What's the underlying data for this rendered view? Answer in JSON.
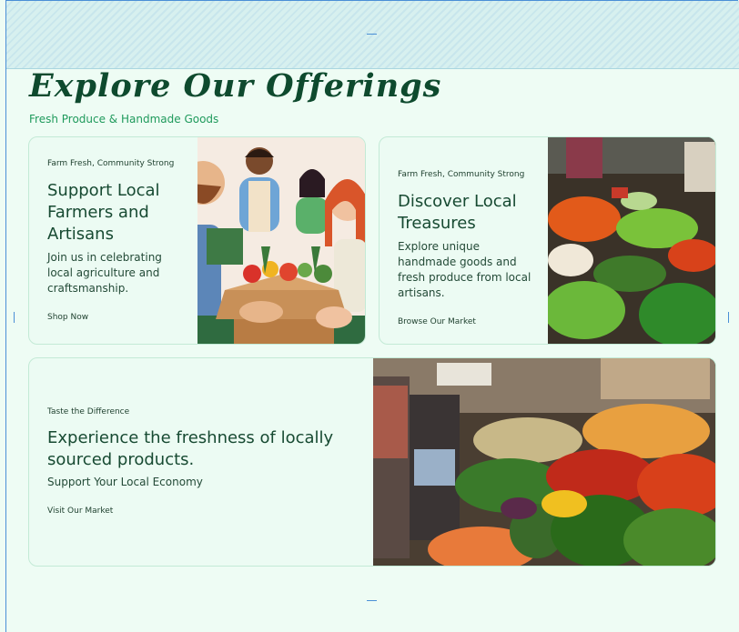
{
  "section": {
    "title": "Explore Our Offerings",
    "subtitle": "Fresh Produce & Handmade Goods"
  },
  "cards": [
    {
      "eyebrow": "Farm Fresh, Community Strong",
      "heading": "Support Local Farmers and Artisans",
      "body": "Join us in celebrating local agriculture and craftsmanship.",
      "link": "Shop Now"
    },
    {
      "eyebrow": "Farm Fresh, Community Strong",
      "heading": "Discover Local Treasures",
      "body": "Explore unique handmade goods and fresh produce from local artisans.",
      "link": "Browse Our Market"
    },
    {
      "eyebrow": "Taste the Difference",
      "heading": "Experience the freshness of locally sourced products.",
      "body": "Support Your Local Economy",
      "link": "Visit Our Market"
    }
  ],
  "colors": {
    "background": "#eefcf4",
    "title": "#0e4a2e",
    "accent": "#1f9a5c",
    "card_border": "#c3ead6"
  }
}
